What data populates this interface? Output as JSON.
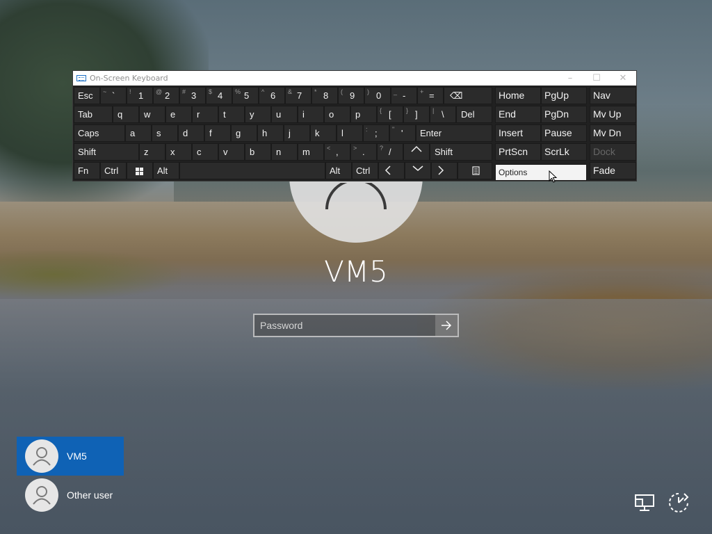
{
  "osk": {
    "title": "On-Screen Keyboard",
    "window_buttons": [
      "–",
      "☐",
      "✕"
    ],
    "keys": {
      "esc": "Esc",
      "number_row": [
        {
          "shift": "~",
          "main": "`"
        },
        {
          "shift": "!",
          "main": "1"
        },
        {
          "shift": "@",
          "main": "2"
        },
        {
          "shift": "#",
          "main": "3"
        },
        {
          "shift": "$",
          "main": "4"
        },
        {
          "shift": "%",
          "main": "5"
        },
        {
          "shift": "^",
          "main": "6"
        },
        {
          "shift": "&",
          "main": "7"
        },
        {
          "shift": "*",
          "main": "8"
        },
        {
          "shift": "(",
          "main": "9"
        },
        {
          "shift": ")",
          "main": "0"
        },
        {
          "shift": "_",
          "main": "-"
        },
        {
          "shift": "+",
          "main": "="
        }
      ],
      "backspace": "⌫",
      "tab": "Tab",
      "row_q": [
        "q",
        "w",
        "e",
        "r",
        "t",
        "y",
        "u",
        "i",
        "o",
        "p"
      ],
      "bracket_l": {
        "shift": "{",
        "main": "["
      },
      "bracket_r": {
        "shift": "}",
        "main": "]"
      },
      "backslash": {
        "shift": "|",
        "main": "\\"
      },
      "del": "Del",
      "caps": "Caps",
      "row_a": [
        "a",
        "s",
        "d",
        "f",
        "g",
        "h",
        "j",
        "k",
        "l"
      ],
      "semicolon": {
        "shift": ":",
        "main": ";"
      },
      "quote": {
        "shift": "\"",
        "main": "'"
      },
      "enter": "Enter",
      "shift": "Shift",
      "row_z": [
        "z",
        "x",
        "c",
        "v",
        "b",
        "n",
        "m"
      ],
      "comma": {
        "shift": "<",
        "main": ","
      },
      "period": {
        "shift": ">",
        "main": "."
      },
      "slash": {
        "shift": "?",
        "main": "/"
      },
      "fn": "Fn",
      "ctrl": "Ctrl",
      "alt": "Alt",
      "nav": {
        "home": "Home",
        "pgup": "PgUp",
        "nav": "Nav",
        "end": "End",
        "pgdn": "PgDn",
        "mvup": "Mv Up",
        "insert": "Insert",
        "pause": "Pause",
        "mvdn": "Mv Dn",
        "prtscn": "PrtScn",
        "scrlk": "ScrLk",
        "dock": "Dock",
        "options": "Options",
        "fade": "Fade"
      }
    }
  },
  "login": {
    "username": "VM5",
    "password_placeholder": "Password"
  },
  "users": [
    {
      "name": "VM5",
      "selected": true
    },
    {
      "name": "Other user",
      "selected": false
    }
  ],
  "colors": {
    "selected_user": "#0f62b5",
    "osk_key": "#2b2b2b",
    "osk_bg": "#212121"
  },
  "icons": {
    "network": "network-icon",
    "power": "power-icon",
    "ease_of_access": "ease-of-access-icon"
  }
}
